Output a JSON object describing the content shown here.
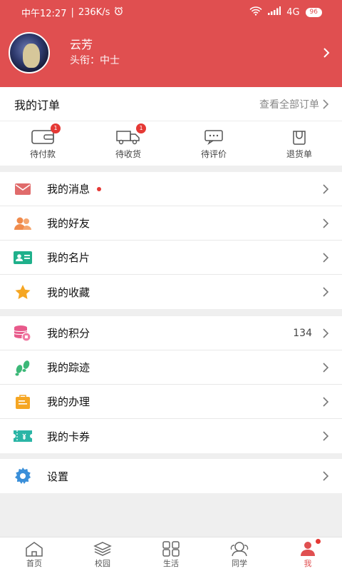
{
  "status": {
    "time": "中午12:27",
    "separator": "|",
    "speed": "236K/s",
    "network": "4G",
    "battery": "96"
  },
  "profile": {
    "name": "云芳",
    "title": "头衔：中士"
  },
  "orders": {
    "header": "我的订单",
    "view_all": "查看全部订单",
    "tabs": [
      {
        "label": "待付款",
        "badge": "1"
      },
      {
        "label": "待收货",
        "badge": "1"
      },
      {
        "label": "待评价"
      },
      {
        "label": "退货单"
      }
    ]
  },
  "menu1": [
    {
      "label": "我的消息"
    },
    {
      "label": "我的好友"
    },
    {
      "label": "我的名片"
    },
    {
      "label": "我的收藏"
    }
  ],
  "menu2": [
    {
      "label": "我的积分",
      "value": "134"
    },
    {
      "label": "我的踪迹"
    },
    {
      "label": "我的办理"
    },
    {
      "label": "我的卡券"
    }
  ],
  "menu3": [
    {
      "label": "设置"
    }
  ],
  "tabbar": [
    {
      "label": "首页"
    },
    {
      "label": "校园"
    },
    {
      "label": "生活"
    },
    {
      "label": "同学"
    },
    {
      "label": "我"
    }
  ],
  "colors": {
    "brand": "#e04f50",
    "badge": "#e53935"
  }
}
